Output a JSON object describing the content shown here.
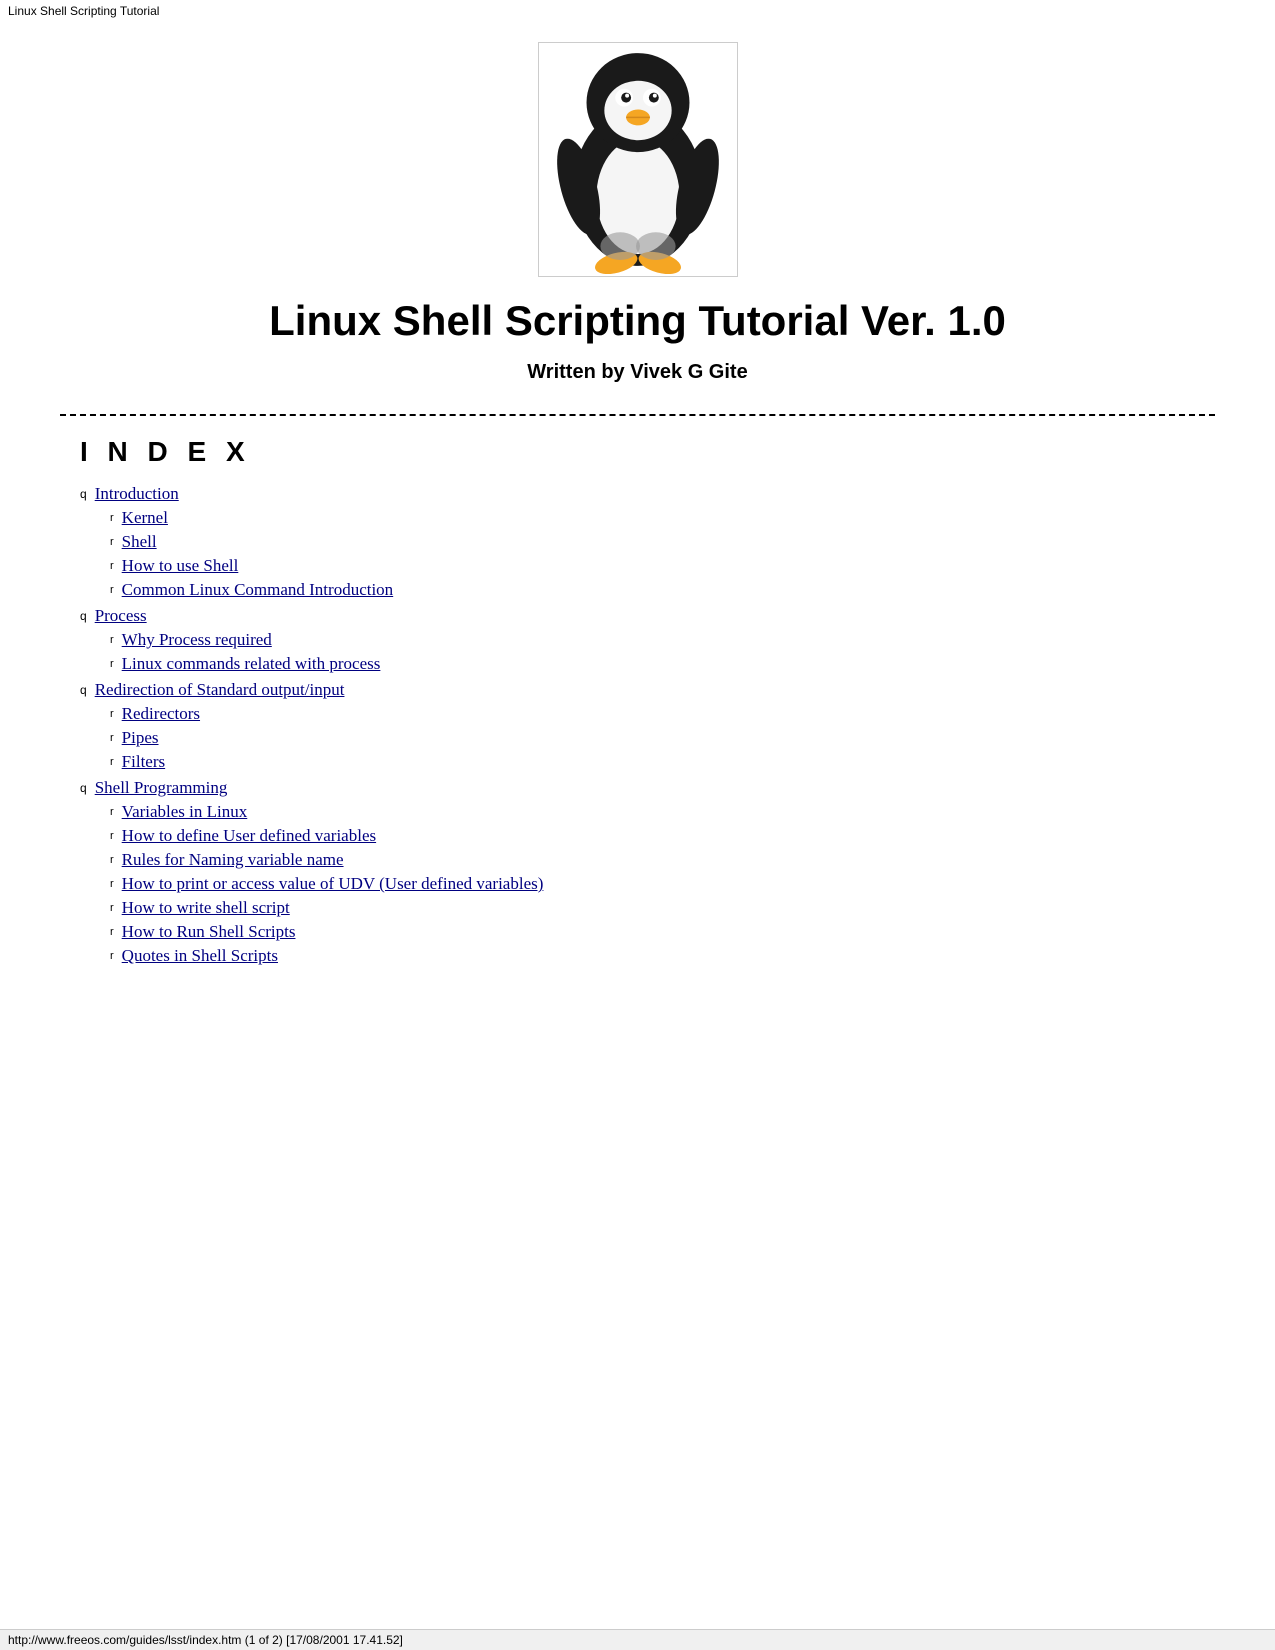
{
  "browser_title": "Linux Shell Scripting Tutorial",
  "header": {
    "main_title": "Linux Shell Scripting Tutorial Ver. 1.0",
    "subtitle": "Written by Vivek G Gite"
  },
  "index": {
    "title": "I N D E X",
    "sections": [
      {
        "label": "Introduction",
        "href": "#introduction",
        "bullet": "q",
        "children": [
          {
            "label": "Kernel",
            "href": "#kernel",
            "bullet": "r"
          },
          {
            "label": "Shell",
            "href": "#shell",
            "bullet": "r"
          },
          {
            "label": "How to use Shell",
            "href": "#how-to-use-shell",
            "bullet": "r"
          },
          {
            "label": "Common Linux Command Introduction",
            "href": "#common-linux",
            "bullet": "r"
          }
        ]
      },
      {
        "label": "Process",
        "href": "#process",
        "bullet": "q",
        "children": [
          {
            "label": "Why Process required",
            "href": "#why-process",
            "bullet": "r"
          },
          {
            "label": "Linux commands related with process",
            "href": "#linux-commands-process",
            "bullet": "r"
          }
        ]
      },
      {
        "label": "Redirection of Standard output/input",
        "href": "#redirection",
        "bullet": "q",
        "children": [
          {
            "label": "Redirectors",
            "href": "#redirectors",
            "bullet": "r"
          },
          {
            "label": "Pipes",
            "href": "#pipes",
            "bullet": "r"
          },
          {
            "label": "Filters",
            "href": "#filters",
            "bullet": "r"
          }
        ]
      },
      {
        "label": "Shell Programming",
        "href": "#shell-programming",
        "bullet": "q",
        "children": [
          {
            "label": "Variables in Linux",
            "href": "#variables",
            "bullet": "r"
          },
          {
            "label": "How to define User defined variables",
            "href": "#user-variables",
            "bullet": "r"
          },
          {
            "label": "Rules for Naming variable name",
            "href": "#naming-rules",
            "bullet": "r"
          },
          {
            "label": "How to print or access value of UDV (User defined variables)",
            "href": "#print-udv",
            "bullet": "r"
          },
          {
            "label": "How to write shell script",
            "href": "#write-shell",
            "bullet": "r"
          },
          {
            "label": "How to Run Shell Scripts",
            "href": "#run-shell",
            "bullet": "r"
          },
          {
            "label": "Quotes in Shell Scripts",
            "href": "#quotes",
            "bullet": "r"
          }
        ]
      }
    ]
  },
  "status_bar": "http://www.freeos.com/guides/lsst/index.htm (1 of 2) [17/08/2001 17.41.52]"
}
